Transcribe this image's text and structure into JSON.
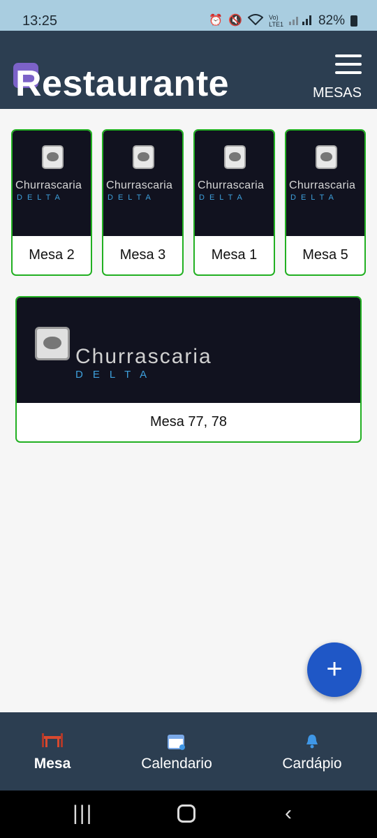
{
  "status_bar": {
    "time": "13:25",
    "battery": "82%",
    "icons": [
      "alarm-icon",
      "mute-icon",
      "wifi-icon",
      "volte-icon",
      "signal-icon",
      "battery-icon"
    ]
  },
  "header": {
    "title": "Restaurante",
    "nav_link": "MESAS",
    "colors": {
      "background": "#2c3e51",
      "badge": "#7c62c8"
    }
  },
  "tables": [
    {
      "label": "Mesa 2",
      "brand": "Churrascaria",
      "brand_sub": "DELTA"
    },
    {
      "label": "Mesa 3",
      "brand": "Churrascaria",
      "brand_sub": "DELTA"
    },
    {
      "label": "Mesa 1",
      "brand": "Churrascaria",
      "brand_sub": "DELTA"
    },
    {
      "label": "Mesa 5",
      "brand": "Churrascaria",
      "brand_sub": "DELTA"
    },
    {
      "label": "Mesa 77, 78",
      "brand": "Churrascaria",
      "brand_sub": "DELTA"
    }
  ],
  "fab": {
    "label": "+",
    "color": "#1f57c6"
  },
  "bottom_nav": {
    "items": [
      {
        "label": "Mesa",
        "icon": "dining-table-icon",
        "active": true
      },
      {
        "label": "Calendario",
        "icon": "calendar-icon",
        "active": false
      },
      {
        "label": "Cardápio",
        "icon": "bell-icon",
        "active": false
      }
    ]
  },
  "accent_colors": {
    "card_border": "#22b022",
    "brand_sub": "#3ea0dc"
  }
}
